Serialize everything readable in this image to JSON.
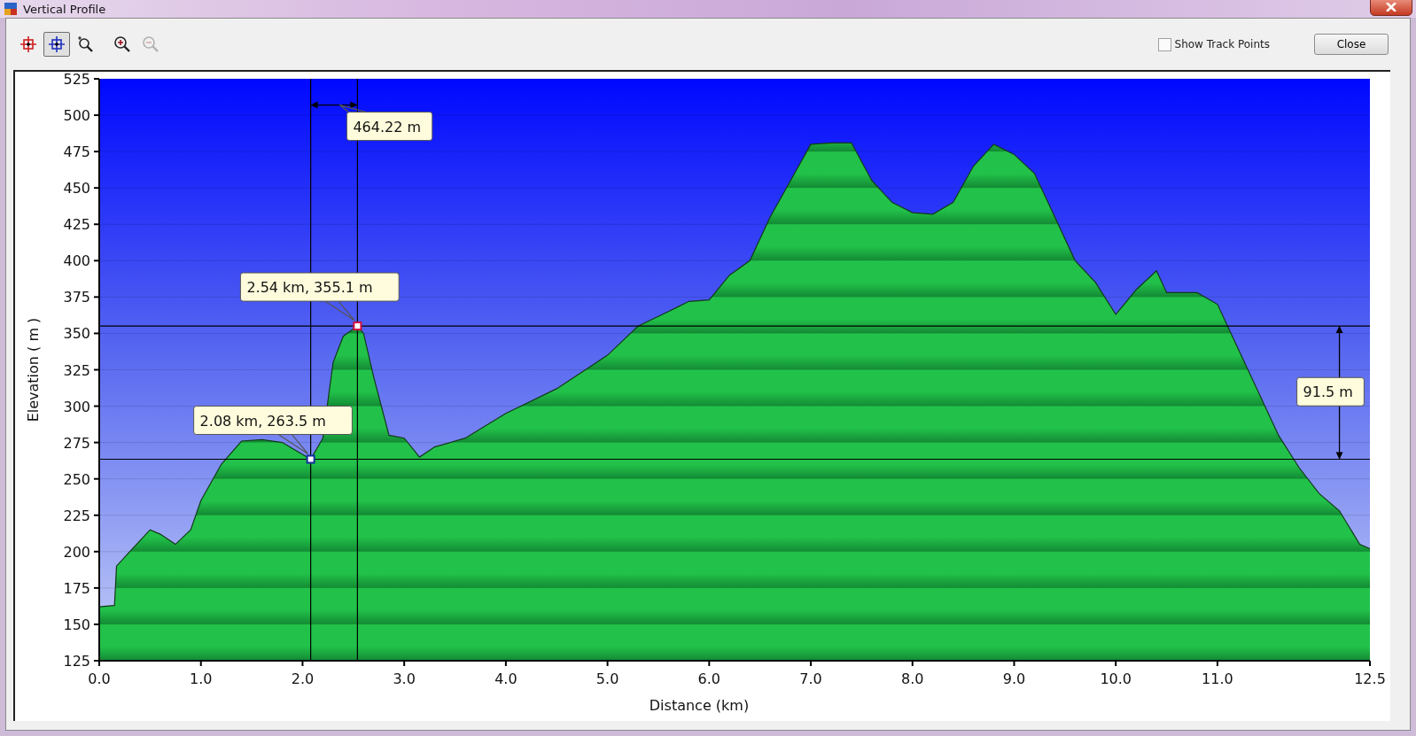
{
  "window": {
    "title": "Vertical Profile"
  },
  "toolbar": {
    "tools": [
      {
        "kind": "crosshair-red",
        "selected": false,
        "disabled": false
      },
      {
        "kind": "crosshair-blue",
        "selected": true,
        "disabled": false
      },
      {
        "kind": "zoom-box",
        "selected": false,
        "disabled": false
      },
      {
        "kind": "zoom-in",
        "selected": false,
        "disabled": false
      },
      {
        "kind": "zoom-out",
        "selected": false,
        "disabled": true
      }
    ],
    "show_track_points": {
      "label": "Show Track Points",
      "checked": false
    },
    "close_button": "Close"
  },
  "chart": {
    "chart_data": {
      "type": "area",
      "xlabel": "Distance  (km)",
      "ylabel": "Elevation ( m )",
      "x": [
        0.0,
        0.15,
        0.17,
        0.3,
        0.5,
        0.6,
        0.75,
        0.9,
        1.0,
        1.2,
        1.4,
        1.6,
        1.8,
        2.0,
        2.08,
        2.2,
        2.3,
        2.4,
        2.54,
        2.6,
        2.7,
        2.85,
        3.0,
        3.15,
        3.3,
        3.6,
        4.0,
        4.5,
        5.0,
        5.3,
        5.6,
        5.8,
        6.0,
        6.2,
        6.4,
        6.6,
        6.8,
        7.0,
        7.2,
        7.4,
        7.6,
        7.8,
        8.0,
        8.2,
        8.4,
        8.6,
        8.8,
        9.0,
        9.2,
        9.4,
        9.6,
        9.8,
        10.0,
        10.2,
        10.4,
        10.5,
        10.8,
        11.0,
        11.2,
        11.4,
        11.6,
        11.8,
        12.0,
        12.2,
        12.4,
        12.5
      ],
      "series": [
        {
          "color": "#22c24a",
          "values": [
            162,
            163,
            190,
            200,
            215,
            212,
            205,
            215,
            235,
            260,
            276,
            277,
            275,
            null,
            263.5,
            278,
            330,
            348,
            355.1,
            350,
            320,
            280,
            278,
            265,
            272,
            278,
            295,
            312,
            335,
            355,
            365,
            372,
            373,
            390,
            400,
            430,
            455,
            480,
            481,
            481,
            455,
            440,
            433,
            432,
            440,
            465,
            480,
            473,
            460,
            430,
            400,
            385,
            363,
            380,
            393,
            378,
            378,
            370,
            340,
            310,
            280,
            258,
            240,
            228,
            205,
            202
          ]
        }
      ],
      "xlim": [
        0,
        12.5
      ],
      "ylim": [
        125,
        525
      ],
      "xticks": [
        {
          "value": 0,
          "label": "0.0"
        },
        {
          "value": 1,
          "label": "1.0"
        },
        {
          "value": 2,
          "label": "2.0"
        },
        {
          "value": 3,
          "label": "3.0"
        },
        {
          "value": 4,
          "label": "4.0"
        },
        {
          "value": 5,
          "label": "5.0"
        },
        {
          "value": 6,
          "label": "6.0"
        },
        {
          "value": 7,
          "label": "7.0"
        },
        {
          "value": 8,
          "label": "8.0"
        },
        {
          "value": 9,
          "label": "9.0"
        },
        {
          "value": 10,
          "label": "10.0"
        },
        {
          "value": 11,
          "label": "11.0"
        },
        {
          "value": 12.5,
          "label": "12.5"
        }
      ],
      "yticks": [
        125,
        150,
        175,
        200,
        225,
        250,
        275,
        300,
        325,
        350,
        375,
        400,
        425,
        450,
        475,
        500,
        525
      ],
      "grid": true,
      "annotations": [
        {
          "x": 2.08,
          "y": 263.5,
          "text": "2.08 km, 263.5 m"
        },
        {
          "x": 2.54,
          "y": 355.1,
          "text": "2.54 km, 355.1 m"
        }
      ]
    },
    "measurements": {
      "horizontal_span": "464.22 m",
      "vertical_span": "91.5 m"
    }
  }
}
